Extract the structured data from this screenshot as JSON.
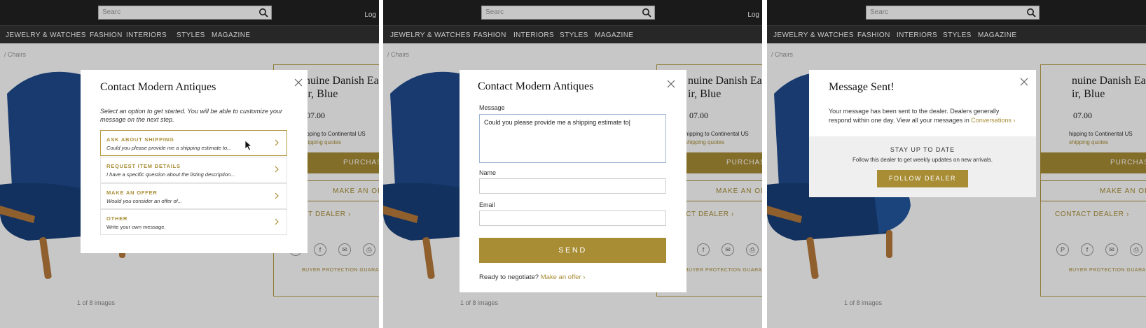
{
  "header": {
    "search_placeholder": "Searc",
    "login_label": "Log"
  },
  "nav": {
    "items": [
      "JEWELRY & WATCHES",
      "FASHION",
      "INTERIORS",
      "STYLES",
      "MAGAZINE"
    ]
  },
  "page": {
    "breadcrumb": "/ Chairs",
    "image_count": "1 of 8 images",
    "title_line1": "nuine Danish Ea",
    "title_line2": "ir, Blue",
    "price": "07.00",
    "shipping_line": "hipping to Continental US",
    "shipping_quotes": "shipping quotes",
    "purchase_label": "PURCHAS",
    "make_offer_label": "MAKE AN OF",
    "contact_dealer_label": "CONTACT DEALER ›",
    "contact_dealer_label_short": "TACT DEALER ›",
    "buyer_protection": "BUYER PROTECTION GUARA",
    "social_icons": [
      "P",
      "f",
      "✉",
      "⎙"
    ]
  },
  "modal1": {
    "title": "Contact Modern Antiques",
    "intro": "Select an option to get started. You will be able to customize your message on the next step.",
    "options": [
      {
        "title": "ASK ABOUT SHIPPING",
        "subtitle": "Could you please provide me a shipping estimate to..."
      },
      {
        "title": "REQUEST ITEM DETAILS",
        "subtitle": "I have a specific question about the listing description..."
      },
      {
        "title": "MAKE AN OFFER",
        "subtitle": "Would you consider an offer of..."
      },
      {
        "title": "OTHER",
        "subtitle": "Write your own message."
      }
    ]
  },
  "modal2": {
    "title": "Contact Modern Antiques",
    "message_label": "Message",
    "message_value": "Could you please provide me a shipping estimate to|",
    "name_label": "Name",
    "name_value": "",
    "email_label": "Email",
    "email_value": "",
    "send_label": "SEND",
    "negotiate_text": "Ready to negotiate?",
    "make_offer_link": "Make an offer ›"
  },
  "modal3": {
    "title": "Message Sent!",
    "body": "Your message has been sent to the dealer. Dealers generally respond within one day. View all your messages in",
    "conversations_link": "Conversations ›",
    "stay_title": "STAY UP TO DATE",
    "stay_sub": "Follow this dealer to get weekly updates on new arrivals.",
    "follow_label": "FOLLOW DEALER"
  },
  "colors": {
    "gold": "#a88d35",
    "topbar": "#222222",
    "chair_blue": "#1f4b8e"
  }
}
